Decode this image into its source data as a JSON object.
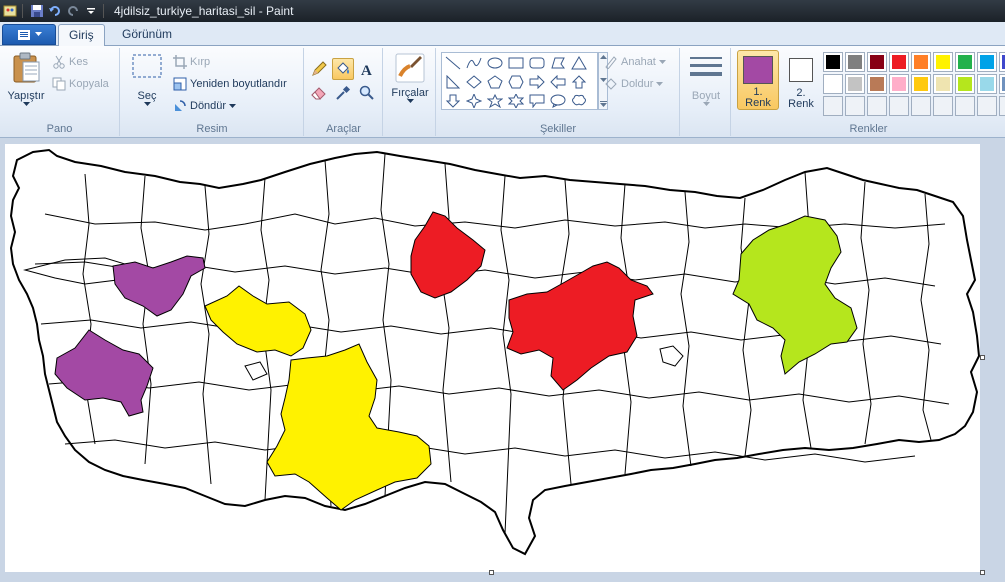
{
  "window": {
    "title": "4jdilsiz_turkiye_haritasi_sil - Paint"
  },
  "tabs": {
    "file_icon": "menu-icon",
    "items": [
      {
        "label": "Giriş",
        "active": true
      },
      {
        "label": "Görünüm",
        "active": false
      }
    ]
  },
  "ribbon": {
    "pano": {
      "label": "Pano",
      "paste": "Yapıştır",
      "cut": "Kes",
      "copy": "Kopyala"
    },
    "resim": {
      "label": "Resim",
      "select": "Seç",
      "crop": "Kırp",
      "resize": "Yeniden boyutlandır",
      "rotate": "Döndür"
    },
    "araclar": {
      "label": "Araçlar",
      "tools": [
        "pencil-icon",
        "fill-icon",
        "text-icon",
        "eraser-icon",
        "color-picker-icon",
        "magnifier-icon"
      ],
      "selected_tool": "fill-icon"
    },
    "fircalar": {
      "label": "Fırçalar"
    },
    "sekiller": {
      "label": "Şekiller",
      "outline": "Anahat",
      "fill": "Doldur"
    },
    "boyut": {
      "label": "Boyut"
    },
    "renkler": {
      "label": "Renkler",
      "color1_label": "1.",
      "color1_sub": "Renk",
      "color2_label": "2.",
      "color2_sub": "Renk",
      "color1": "#a349a4",
      "color2": "#ffffff",
      "palette_row1": [
        "#000000",
        "#7f7f7f",
        "#880015",
        "#ed1c24",
        "#ff7f27",
        "#fff200",
        "#22b14c",
        "#00a2e8",
        "#3f48cc"
      ],
      "palette_row2": [
        "#ffffff",
        "#c3c3c3",
        "#b97a57",
        "#ffaec9",
        "#ffc90e",
        "#efe4b0",
        "#b5e61d",
        "#99d9ea",
        "#7092be"
      ]
    }
  },
  "map": {
    "colors": {
      "purple": "#a349a4",
      "yellow": "#fff200",
      "red": "#ed1c24",
      "green": "#b5e61d",
      "outline": "#000000"
    }
  }
}
